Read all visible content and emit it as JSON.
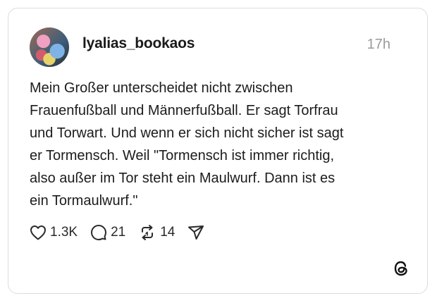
{
  "post": {
    "username": "lyalias_bookaos",
    "time": "17h",
    "text": "Mein Großer unterscheidet nicht zwischen\nFrauenfußball und Männerfußball. Er sagt Torfrau\nund Torwart. Und wenn er sich nicht sicher ist sagt\ner Tormensch. Weil \"Tormensch ist immer richtig,\nalso außer im Tor steht ein Maulwurf. Dann ist es\nein Tormaulwurf.\"",
    "likes": "1.3K",
    "replies": "21",
    "reposts": "14"
  },
  "icons": {
    "like": "heart-icon",
    "reply": "comment-icon",
    "repost": "repost-icon",
    "share": "send-icon",
    "brand": "threads-logo-icon"
  }
}
